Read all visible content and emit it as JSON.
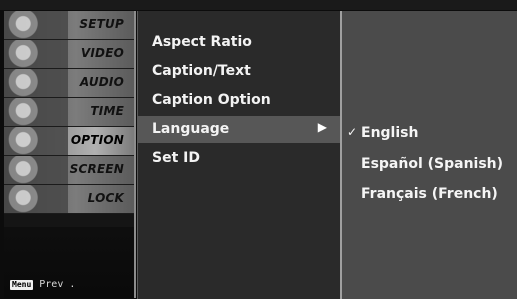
{
  "left_menu": {
    "items": [
      {
        "label": "SETUP"
      },
      {
        "label": "VIDEO"
      },
      {
        "label": "AUDIO"
      },
      {
        "label": "TIME"
      },
      {
        "label": "OPTION"
      },
      {
        "label": "SCREEN"
      },
      {
        "label": "LOCK"
      }
    ],
    "selected": "OPTION",
    "footer": {
      "key": "Menu",
      "label": "Prev ."
    }
  },
  "option_menu": {
    "items": [
      {
        "label": "Aspect Ratio"
      },
      {
        "label": "Caption/Text"
      },
      {
        "label": "Caption Option"
      },
      {
        "label": "Language",
        "arrow": "▶"
      },
      {
        "label": "Set ID"
      }
    ],
    "active": "Language"
  },
  "language_submenu": {
    "checkmark": "✓",
    "items": [
      {
        "label": "English",
        "selected": true
      },
      {
        "label": "Español (Spanish)"
      },
      {
        "label": "Français (French)"
      }
    ]
  }
}
